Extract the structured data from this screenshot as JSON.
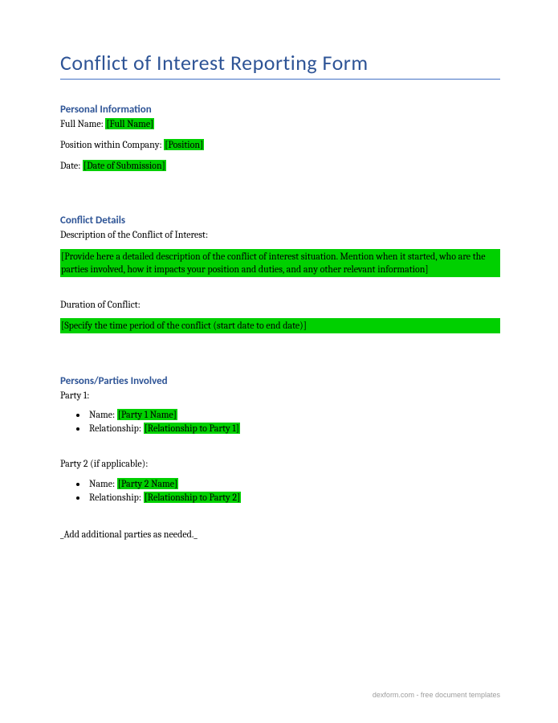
{
  "title": "Conflict of Interest Reporting Form",
  "sections": {
    "personal": {
      "heading": "Personal Information",
      "fullNameLabel": "Full Name:",
      "fullNamePlaceholder": "[Full Name]",
      "positionLabel": "Position within Company:",
      "positionPlaceholder": "[Position]",
      "dateLabel": "Date:",
      "datePlaceholder": "[Date of Submission]"
    },
    "conflict": {
      "heading": "Conflict Details",
      "descLabel": "Description of the Conflict of Interest:",
      "descPlaceholder": "[Provide here a detailed description of the conflict of interest situation. Mention when it started, who are the parties involved, how it impacts your position and duties, and any other relevant information]",
      "durationLabel": "Duration of Conflict:",
      "durationPlaceholder": "[Specify the time period of the conflict (start date to end date)]"
    },
    "parties": {
      "heading": "Persons/Parties Involved",
      "party1Label": "Party 1:",
      "party1NameLabel": "Name:",
      "party1NamePlaceholder": "[Party 1 Name]",
      "party1RelLabel": "Relationship:",
      "party1RelPlaceholder": "[Relationship to Party 1]",
      "party2Label": "Party 2 (if applicable):",
      "party2NameLabel": "Name:",
      "party2NamePlaceholder": "[Party 2 Name]",
      "party2RelLabel": "Relationship:",
      "party2RelPlaceholder": "[Relationship to Party 2]",
      "addNote": "_Add additional parties as needed._"
    }
  },
  "footer": {
    "brand": "dexform.com",
    "tagline": " - free document templates"
  }
}
